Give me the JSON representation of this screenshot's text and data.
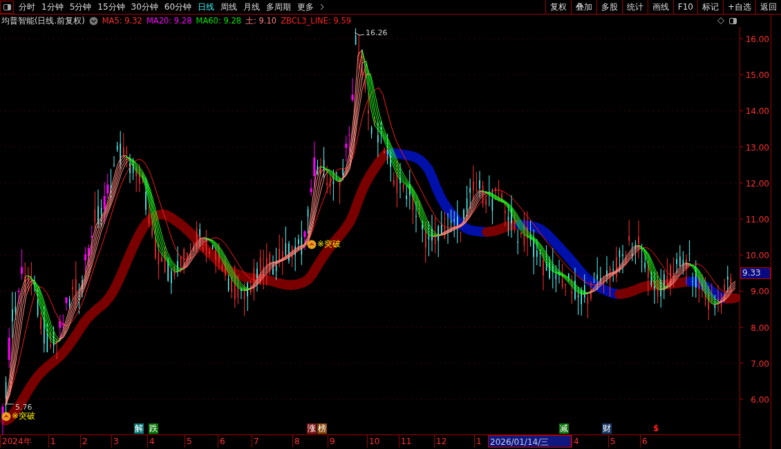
{
  "toolbar": {
    "periods": [
      {
        "label": "分时",
        "selected": false
      },
      {
        "label": "1分钟",
        "selected": false
      },
      {
        "label": "5分钟",
        "selected": false
      },
      {
        "label": "15分钟",
        "selected": false
      },
      {
        "label": "30分钟",
        "selected": false
      },
      {
        "label": "60分钟",
        "selected": false
      },
      {
        "label": "日线",
        "selected": true
      },
      {
        "label": "周线",
        "selected": false
      },
      {
        "label": "月线",
        "selected": false
      },
      {
        "label": "多周期",
        "selected": false
      },
      {
        "label": "更多",
        "selected": false
      }
    ],
    "actions": [
      "复权",
      "叠加",
      "多股",
      "统计",
      "画线",
      "F10",
      "标记",
      "+自选",
      "返回"
    ]
  },
  "legend": {
    "title": "均普智能(日线.前复权)",
    "indicators": [
      {
        "label": "MA5: 9.32",
        "color": "#ff3030"
      },
      {
        "label": "MA20: 9.28",
        "color": "#ff00ff"
      },
      {
        "label": "MA60: 9.28",
        "color": "#00e000"
      },
      {
        "label": "土: 9.10",
        "color": "#ff8080"
      },
      {
        "label": "ZBCL3_LINE: 9.59",
        "color": "#ff2020"
      }
    ]
  },
  "chart": {
    "price_ticks": [
      "16.00",
      "15.00",
      "14.00",
      "13.00",
      "12.00",
      "11.00",
      "10.00",
      "9.00",
      "8.00",
      "7.00",
      "6.00"
    ],
    "current_price": "9.33",
    "high_label": "16.26",
    "low_label": "5.76",
    "signals": [
      {
        "label": "※突破"
      },
      {
        "label": "※突破"
      }
    ],
    "events": [
      {
        "label": "解",
        "color": "#0a7878",
        "kind": "chip"
      },
      {
        "label": "跌",
        "color": "#0a780a",
        "kind": "chip"
      },
      {
        "label": "涨",
        "color": "#801818",
        "kind": "chip"
      },
      {
        "label": "榜",
        "color": "#8a4a0a",
        "kind": "chip"
      },
      {
        "label": "减",
        "color": "#0a780a",
        "kind": "chip"
      },
      {
        "label": "财",
        "color": "#1a3a6a",
        "kind": "chip"
      },
      {
        "label": "$",
        "color": "#ff2020",
        "kind": "text"
      }
    ],
    "date_axis": [
      {
        "label": "2024年",
        "selected": false
      },
      {
        "label": "1",
        "selected": false
      },
      {
        "label": "2",
        "selected": false
      },
      {
        "label": "3",
        "selected": false
      },
      {
        "label": "4",
        "selected": false
      },
      {
        "label": "5",
        "selected": false
      },
      {
        "label": "6",
        "selected": false
      },
      {
        "label": "7",
        "selected": false
      },
      {
        "label": "8",
        "selected": false
      },
      {
        "label": "9",
        "selected": false
      },
      {
        "label": "10",
        "selected": false
      },
      {
        "label": "11",
        "selected": false
      },
      {
        "label": "12",
        "selected": false
      },
      {
        "label": "1",
        "selected": false
      },
      {
        "label": "2026/01/14/三",
        "selected": true
      },
      {
        "label": "4",
        "selected": false
      },
      {
        "label": "5",
        "selected": false
      },
      {
        "label": "6",
        "selected": false
      }
    ]
  }
}
